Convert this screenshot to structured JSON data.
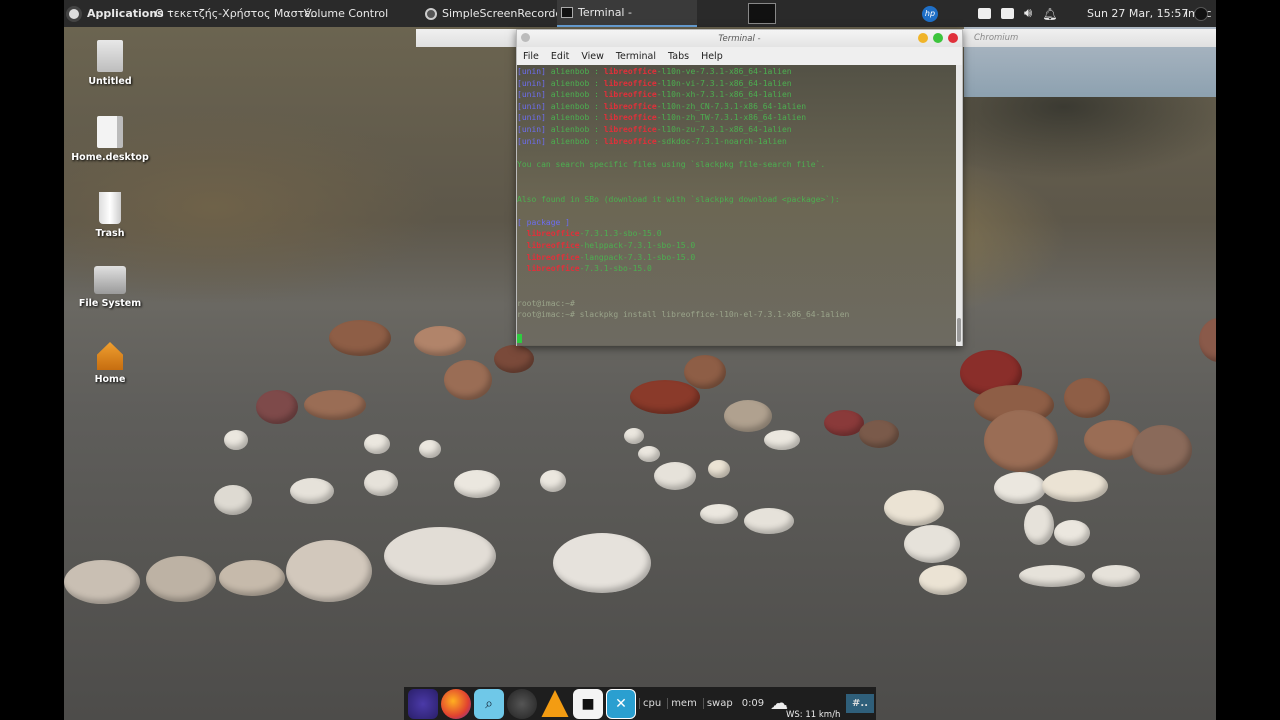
{
  "top_panel": {
    "applications_label": "Applications",
    "separator": "⁝",
    "tasks": [
      {
        "label": "Ο τεκετζής-Χρήστος Μαστέ...",
        "icon": "chromium-icon"
      },
      {
        "label": "Volume Control",
        "icon": "none"
      },
      {
        "label": "SimpleScreenRecorder",
        "icon": "recorder-icon"
      },
      {
        "label": "Terminal -",
        "icon": "terminal-icon"
      }
    ],
    "clock": "Sun 27 Mar, 15:57",
    "user": "imac"
  },
  "desktop_icons": [
    {
      "label": "Untitled",
      "icon": "text-file-icon"
    },
    {
      "label": "Home.desktop",
      "icon": "desktop-file-icon"
    },
    {
      "label": "Trash",
      "icon": "trash-icon"
    },
    {
      "label": "File System",
      "icon": "drive-icon"
    },
    {
      "label": "Home",
      "icon": "home-folder-icon"
    }
  ],
  "terminal": {
    "title": "Terminal -",
    "menu": [
      "File",
      "Edit",
      "View",
      "Terminal",
      "Tabs",
      "Help"
    ],
    "package_lines": [
      {
        "prefix": "[unin]",
        "repo": "alienbob",
        "sep": ":",
        "name": "libreoffice",
        "rest": "-l10n-ve-7.3.1-x86_64-1alien"
      },
      {
        "prefix": "[unin]",
        "repo": "alienbob",
        "sep": ":",
        "name": "libreoffice",
        "rest": "-l10n-vi-7.3.1-x86_64-1alien"
      },
      {
        "prefix": "[unin]",
        "repo": "alienbob",
        "sep": ":",
        "name": "libreoffice",
        "rest": "-l10n-xh-7.3.1-x86_64-1alien"
      },
      {
        "prefix": "[unin]",
        "repo": "alienbob",
        "sep": ":",
        "name": "libreoffice",
        "rest": "-l10n-zh_CN-7.3.1-x86_64-1alien"
      },
      {
        "prefix": "[unin]",
        "repo": "alienbob",
        "sep": ":",
        "name": "libreoffice",
        "rest": "-l10n-zh_TW-7.3.1-x86_64-1alien"
      },
      {
        "prefix": "[unin]",
        "repo": "alienbob",
        "sep": ":",
        "name": "libreoffice",
        "rest": "-l10n-zu-7.3.1-x86_64-1alien"
      },
      {
        "prefix": "[unin]",
        "repo": "alienbob",
        "sep": ":",
        "name": "libreoffice",
        "rest": "-sdkdoc-7.3.1-noarch-1alien"
      }
    ],
    "search_hint": "You can search specific files using `slackpkg file-search file`.",
    "sbo_hint": "Also found in SBo (download it with `slackpkg download <package>`):",
    "package_header": "[ package ]",
    "sbo_lines": [
      {
        "name": "libreoffice",
        "rest": "-7.3.1.3-sbo-15.0"
      },
      {
        "name": "libreoffice",
        "rest": "-helppack-7.3.1-sbo-15.0"
      },
      {
        "name": "libreoffice",
        "rest": "-langpack-7.3.1-sbo-15.0"
      },
      {
        "name": "libreoffice",
        "rest": "-7.3.1-sbo-15.0"
      }
    ],
    "prompt1": "root@imac:~#",
    "prompt2": "root@imac:~# slackpkg install libreoffice-l10n-el-7.3.1-x86_64-1alien"
  },
  "chromium_window": {
    "title": "Chromium"
  },
  "dock": {
    "cpu": "cpu",
    "mem": "mem",
    "swap": "swap",
    "timer": "0:09",
    "weather": "WS: 11 km/h",
    "workspace": "#.."
  }
}
